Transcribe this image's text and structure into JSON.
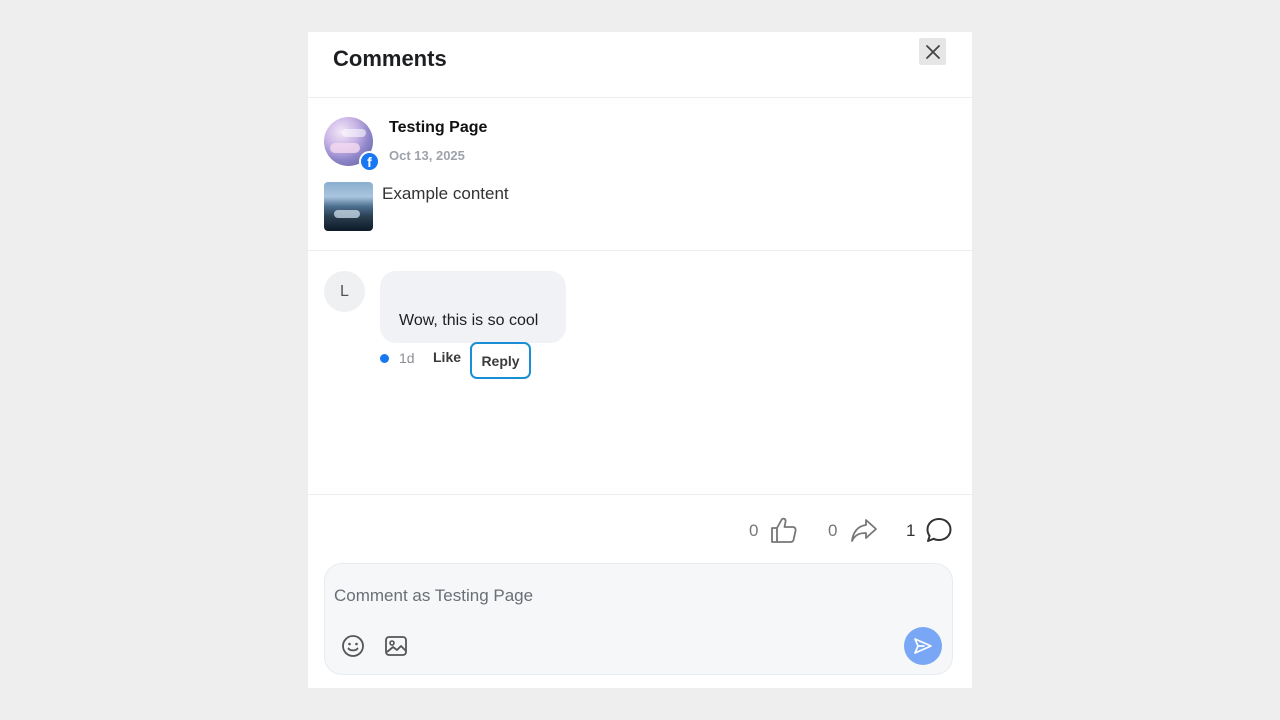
{
  "header": {
    "title": "Comments",
    "close_icon": "close-icon"
  },
  "post": {
    "author": "Testing Page",
    "date": "Oct 13, 2025",
    "text": "Example content",
    "badge_icon": "facebook-icon"
  },
  "comment": {
    "avatar_initial": "L",
    "text": "Wow, this is so cool",
    "time": "1d",
    "like_label": "Like",
    "reply_label": "Reply",
    "unread_dot_color": "#1877f2"
  },
  "stats": {
    "likes": "0",
    "shares": "0",
    "comments": "1",
    "icons": [
      "thumbs-up-icon",
      "share-icon",
      "comment-icon"
    ]
  },
  "composer": {
    "placeholder": "Comment as Testing Page",
    "icons": [
      "emoji-icon",
      "image-icon",
      "send-icon"
    ],
    "send_color": "#7aa7f5"
  }
}
